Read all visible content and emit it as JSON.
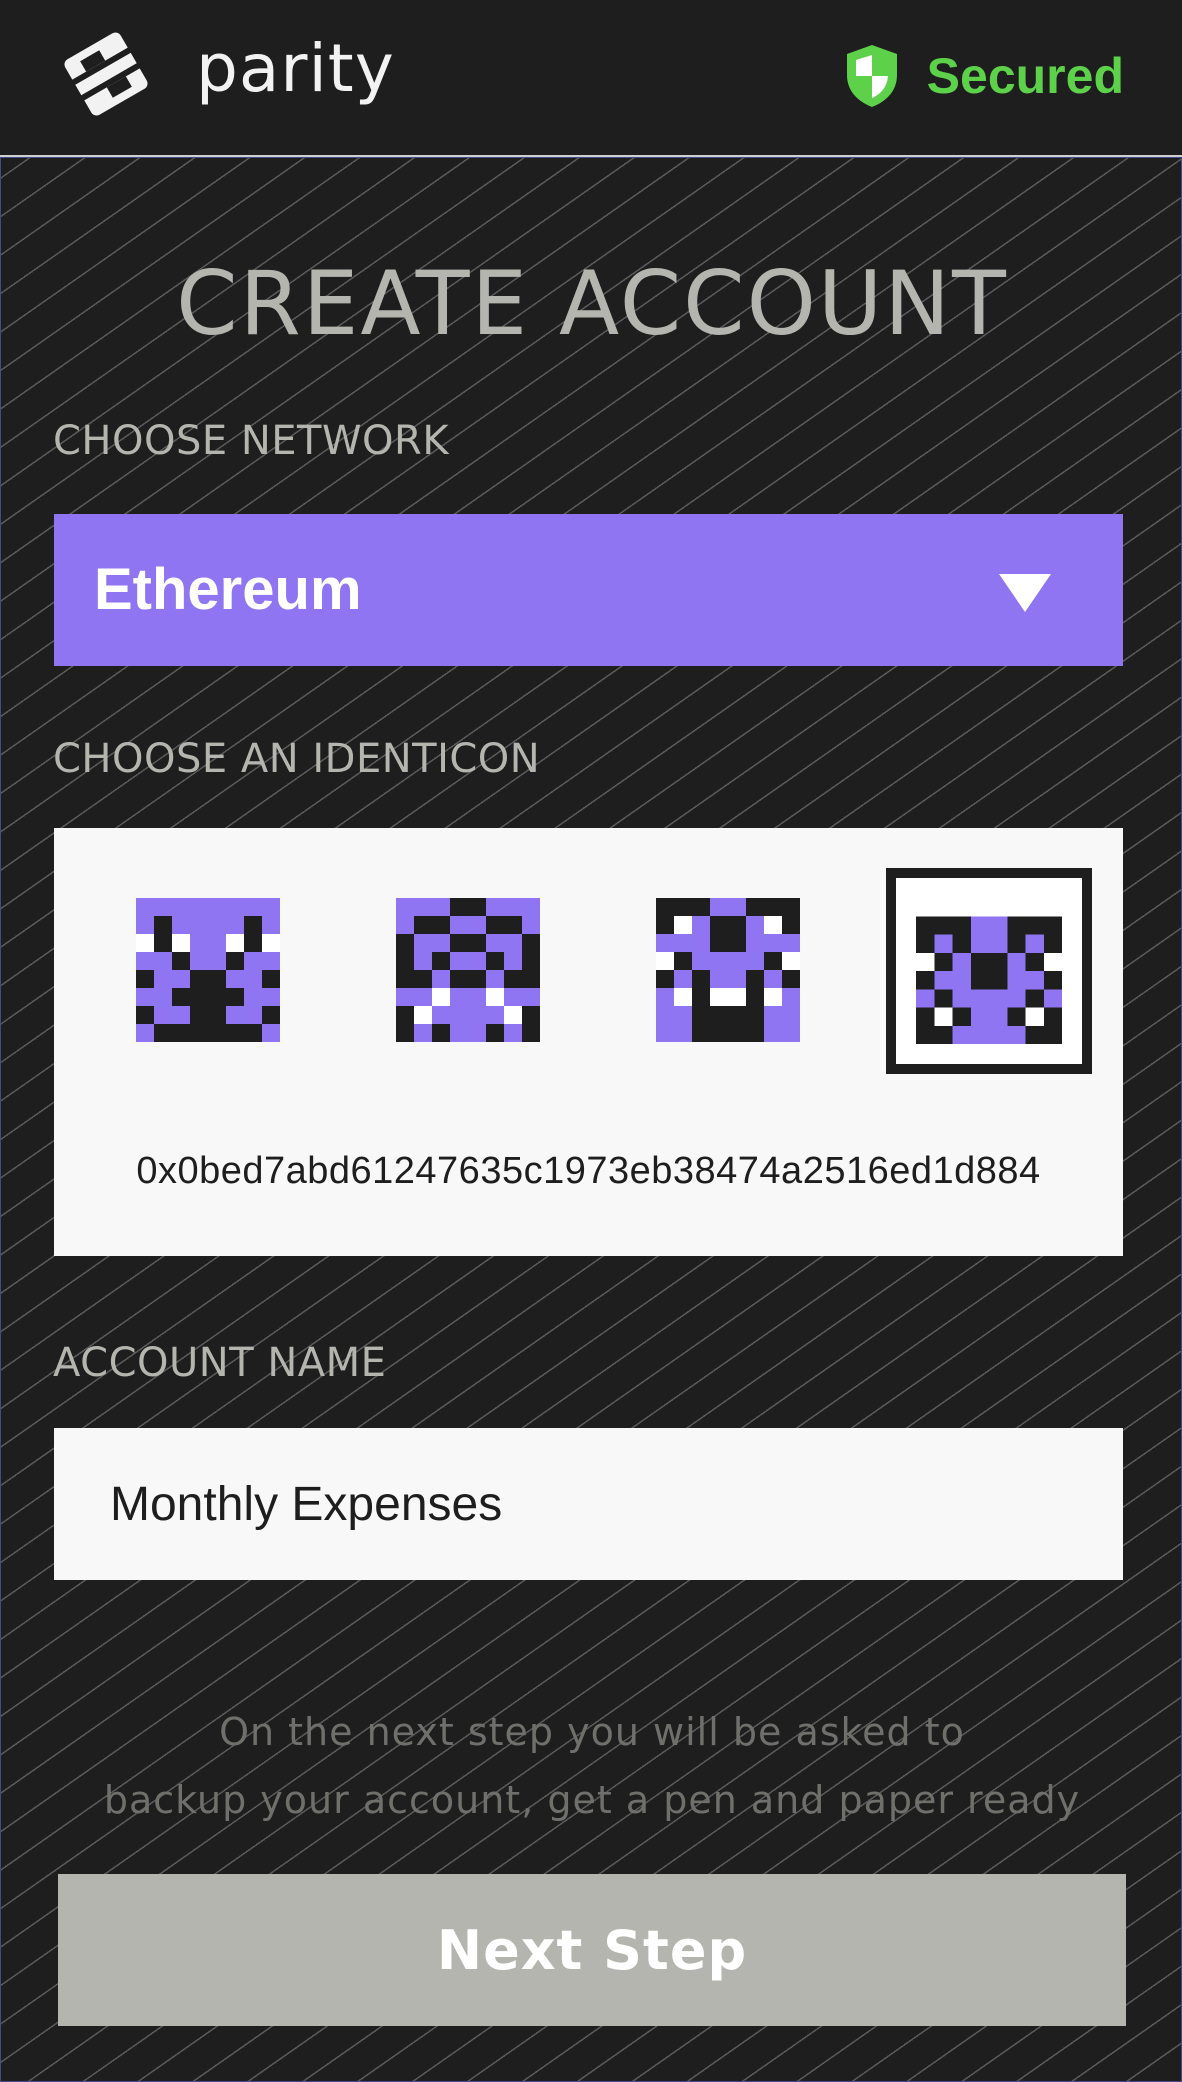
{
  "header": {
    "brand": "parity",
    "logo_icon": "parity-logo-icon",
    "status_icon": "shield-icon",
    "status_label": "Secured",
    "status_color": "#5ed14a"
  },
  "page": {
    "title": "CREATE ACCOUNT"
  },
  "network": {
    "label": "CHOOSE NETWORK",
    "selected": "Ethereum",
    "accent_color": "#8f75f2",
    "dropdown_icon": "triangle-down-icon"
  },
  "identicon": {
    "label": "CHOOSE AN IDENTICON",
    "selected_index": 3,
    "address": "0x0bed7abd61247635c1973eb38474a2516ed1d884"
  },
  "account_name": {
    "label": "ACCOUNT NAME",
    "value": "Monthly Expenses"
  },
  "hint": {
    "line1": "On the next step you will be asked to",
    "line2": "backup your account, get a pen and paper ready"
  },
  "next_button": {
    "label": "Next Step"
  }
}
